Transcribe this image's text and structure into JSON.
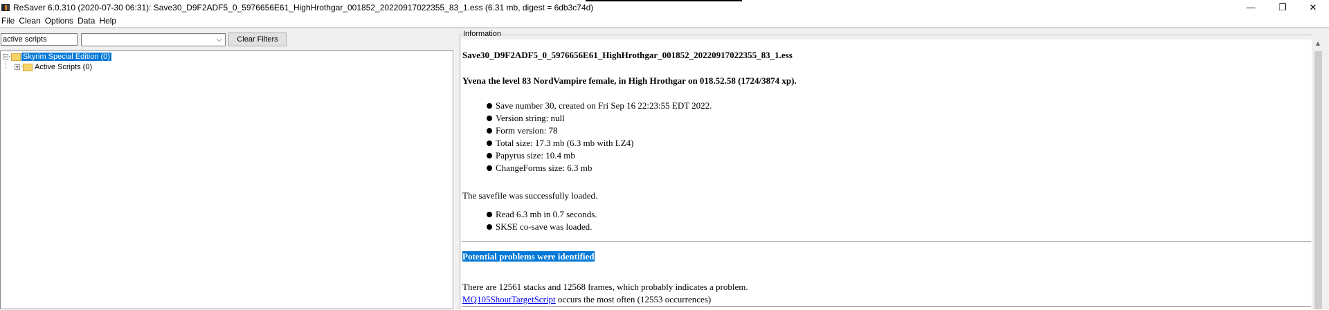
{
  "window": {
    "title": "ReSaver 6.0.310 (2020-07-30 06:31): Save30_D9F2ADF5_0_5976656E61_HighHrothgar_001852_20220917022355_83_1.ess (6.31 mb, digest = 6db3c74d)",
    "minimize": "—",
    "restore": "❐",
    "close": "✕"
  },
  "menu": [
    "File",
    "Clean",
    "Options",
    "Data",
    "Help"
  ],
  "filters": {
    "search_value": "active scripts",
    "clear_label": "Clear Filters",
    "combo_arrow": "⌵"
  },
  "tree": {
    "root_expander": "−",
    "root_label": "Skyrim Special Edition (0)",
    "child_expander": "+",
    "child_label": "Active Scripts (0)"
  },
  "info": {
    "group_label": "Information",
    "filename": "Save30_D9F2ADF5_0_5976656E61_HighHrothgar_001852_20220917022355_83_1.ess",
    "character": "Yvena the level 83 NordVampire female, in High Hrothgar on 018.52.58 (1724/3874 xp).",
    "details": [
      "Save number 30, created on Fri Sep 16 22:23:55 EDT 2022.",
      "Version string: null",
      "Form version: 78",
      "Total size: 17.3 mb (6.3 mb with LZ4)",
      "Papyrus size: 10.4 mb",
      "ChangeForms size: 6.3 mb"
    ],
    "loaded_text": "The savefile was successfully loaded.",
    "load_details": [
      "Read 6.3 mb in 0.7 seconds.",
      "SKSE co-save was loaded."
    ],
    "problems_heading": "Potential problems were identified",
    "stacks_text": "There are 12561 stacks and 12568 frames, which probably indicates a problem.",
    "script_link": "MQ105ShoutTargetScript",
    "occurs_text": " occurs the most often (12553 occurrences)"
  },
  "scrollbar": {
    "up_arrow": "▲"
  }
}
